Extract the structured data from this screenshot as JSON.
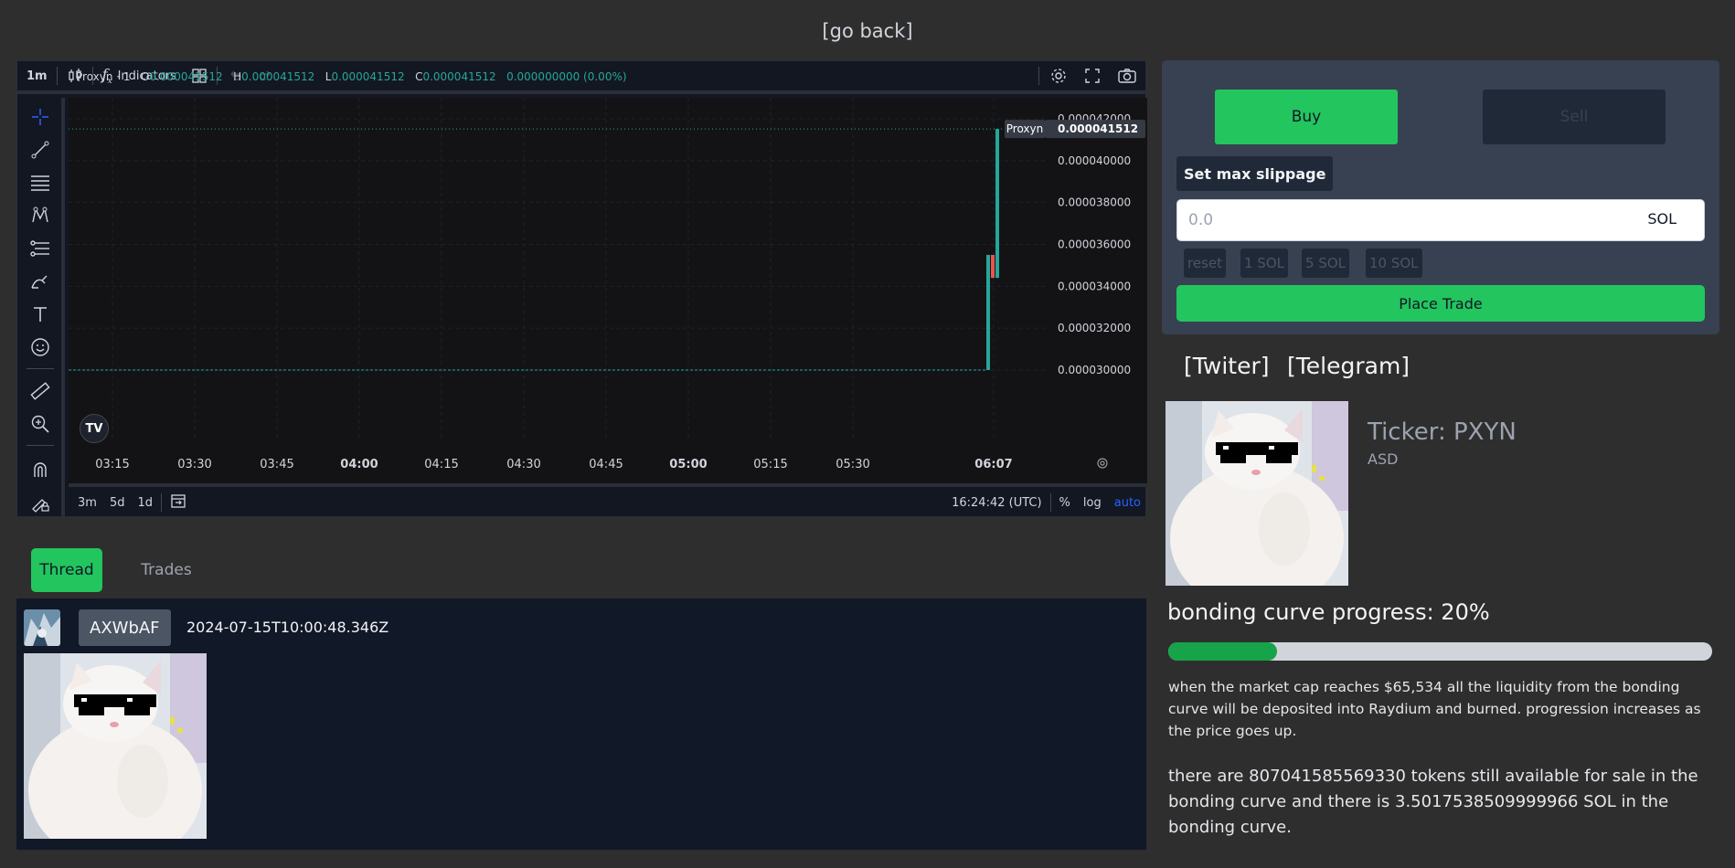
{
  "nav": {
    "go_back": "[go back]"
  },
  "chart_toolbar": {
    "interval": "1m",
    "indicators": "Indicators",
    "fx": "f",
    "fx_sub": "x"
  },
  "chart_legend": {
    "symbol": "Proxyn · 1",
    "open_label": "O",
    "open": "0.000041512",
    "high_label": "H",
    "high": "0.000041512",
    "low_label": "L",
    "low": "0.000041512",
    "close_label": "C",
    "close": "0.000041512",
    "change": "0.000000000 (0.00%)"
  },
  "chart_bottom": {
    "ranges": [
      "3m",
      "5d",
      "1d"
    ],
    "clock": "16:24:42 (UTC)",
    "percent": "%",
    "log": "log",
    "auto": "auto"
  },
  "colors": {
    "up": "#26a69a",
    "down": "#ef5350",
    "accent_green": "#22c55e",
    "auto_blue": "#2962ff"
  },
  "chart_data": {
    "type": "candlestick",
    "symbol_label": "Proxyn",
    "last_price": "0.000041512",
    "y_ticks": [
      "0.000042000",
      "0.000040000",
      "0.000038000",
      "0.000036000",
      "0.000034000",
      "0.000032000",
      "0.000030000"
    ],
    "ylim": [
      3e-05,
      4.2e-05
    ],
    "x_ticks": [
      "03:15",
      "03:30",
      "03:45",
      "04:00",
      "04:15",
      "04:30",
      "04:45",
      "05:00",
      "05:15",
      "05:30",
      "06:07"
    ],
    "x_ticks_bold": [
      "04:00",
      "05:00",
      "06:07"
    ],
    "baseline": 3e-05,
    "candles": [
      {
        "time": "06:05",
        "open": 3e-05,
        "high": 3.55e-05,
        "low": 3e-05,
        "close": 3.55e-05
      },
      {
        "time": "06:06",
        "open": 3.55e-05,
        "high": 3.55e-05,
        "low": 3.44e-05,
        "close": 3.44e-05
      },
      {
        "time": "06:07",
        "open": 3.44e-05,
        "high": 4.1512e-05,
        "low": 3.44e-05,
        "close": 4.1512e-05
      }
    ]
  },
  "tabs": {
    "thread": "Thread",
    "trades": "Trades"
  },
  "thread": {
    "username": "AXWbAF",
    "timestamp": "2024-07-15T10:00:48.346Z"
  },
  "trade": {
    "buy": "Buy",
    "sell": "Sell",
    "slippage": "Set max slippage",
    "amount_placeholder": "0.0",
    "unit": "SOL",
    "quick": [
      "reset",
      "1 SOL",
      "5 SOL",
      "10 SOL"
    ],
    "place": "Place Trade"
  },
  "socials": {
    "twitter": "[Twiter]",
    "telegram": "[Telegram]"
  },
  "token": {
    "ticker": "Ticker: PXYN",
    "description": "ASD"
  },
  "progress": {
    "title": "bonding curve progress: 20%",
    "percent": 20
  },
  "info": {
    "small": "when the market cap reaches $65,534 all the liquidity from the bonding curve will be deposited into Raydium and burned. progression increases as the price goes up.",
    "large": "there are 807041585569330 tokens still available for sale in the bonding curve and there is 3.5017538509999966 SOL in the bonding curve."
  },
  "icons": {
    "crosshair": "crosshair-icon",
    "trend_line": "trend-line-icon",
    "fib": "fib-retracement-icon",
    "pattern": "pattern-icon",
    "forecast": "forecast-icon",
    "brush": "brush-icon",
    "text": "text-icon",
    "emoji": "emoji-icon",
    "ruler": "ruler-icon",
    "zoom": "zoom-in-icon",
    "magnet": "magnet-icon",
    "lock": "lock-drawing-icon"
  }
}
